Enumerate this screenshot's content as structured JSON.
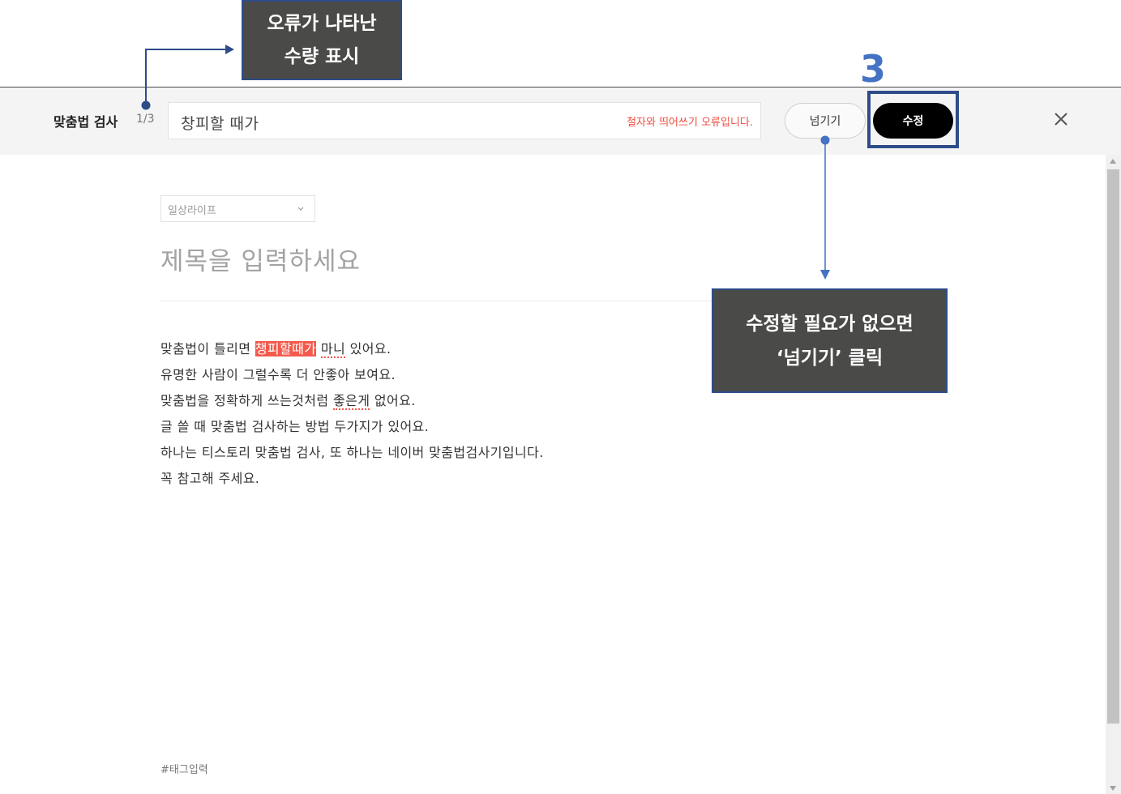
{
  "spellcheck": {
    "title": "맞춤법 검사",
    "count": "1/3",
    "suggestion": "창피할 때가",
    "error_message": "철자와 띄어쓰기 오류입니다.",
    "skip_label": "넘기기",
    "fix_label": "수정",
    "close_icon": "close-icon"
  },
  "editor": {
    "category": "일상라이프",
    "title_placeholder": "제목을 입력하세요",
    "lines": {
      "l1_pre": "맞춤법이 틀리면 ",
      "l1_err": "챙피할때가",
      "l1_mid": " ",
      "l1_err2": "마니",
      "l1_post": " 있어요.",
      "l2": "유명한 사람이 그럴수록 더 안좋아 보여요.",
      "l3_pre": "맞춤법을 정확하게 쓰는것처럼 ",
      "l3_err": "좋은게",
      "l3_post": " 없어요.",
      "l4": "글 쓸 때 맞춤법 검사하는 방법 두가지가 있어요.",
      "l5": "하나는 티스토리 맞춤법 검사, 또 하나는 네이버 맞춤법검사기입니다.",
      "l6": "꼭 참고해 주세요."
    },
    "tag_placeholder": "#태그입력"
  },
  "annotations": {
    "count_note": [
      "오류가 나타난",
      "수량 표시"
    ],
    "step": "3",
    "skip_note": [
      "수정할 필요가 없으면",
      "‘넘기기’ 클릭"
    ],
    "accent_color": "#2e4c88",
    "step_color": "#4472c4"
  },
  "colors": {
    "error": "#f35a4c",
    "toolbar_bg": "#f4f4f4",
    "fix_button": "#000000"
  }
}
